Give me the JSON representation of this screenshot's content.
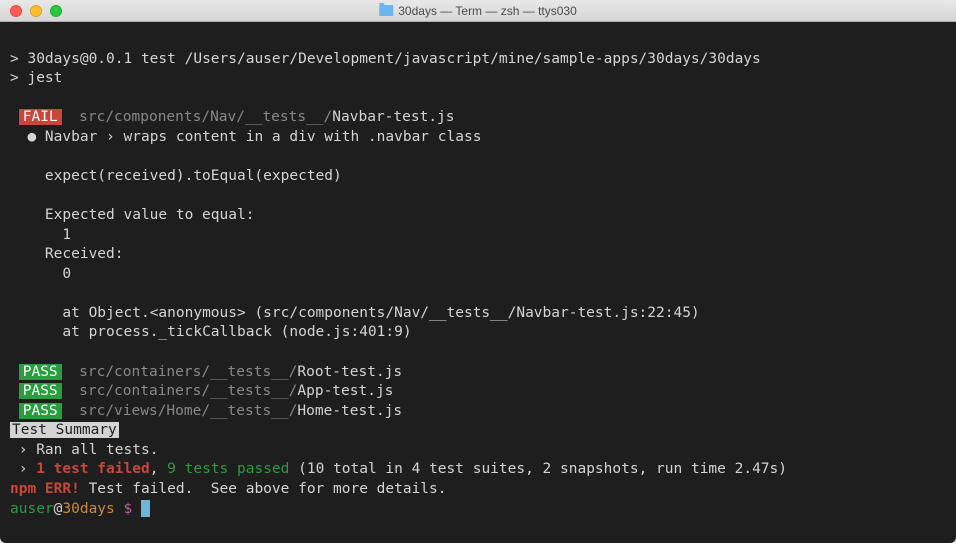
{
  "titlebar": {
    "title": "30days — Term — zsh — ttys030"
  },
  "cmd": {
    "line1_prefix": "> ",
    "line1": "30days@0.0.1 test /Users/auser/Development/javascript/mine/sample-apps/30days/30days",
    "line2_prefix": "> ",
    "line2": "jest"
  },
  "fail": {
    "badge": "FAIL",
    "path_dir": "src/components/Nav/__tests__/",
    "path_file": "Navbar-test.js",
    "bullet": "●",
    "desc": " Navbar › wraps content in a div with .navbar class",
    "expect_line": "expect(received).toEqual(expected)",
    "expected_label": "Expected value to equal:",
    "expected_val": "1",
    "received_label": "Received:",
    "received_val": "0",
    "stack1": "at Object.<anonymous> (src/components/Nav/__tests__/Navbar-test.js:22:45)",
    "stack2": "at process._tickCallback (node.js:401:9)"
  },
  "passes": [
    {
      "badge": "PASS",
      "dir": "src/containers/__tests__/",
      "file": "Root-test.js"
    },
    {
      "badge": "PASS",
      "dir": "src/containers/__tests__/",
      "file": "App-test.js"
    },
    {
      "badge": "PASS",
      "dir": "src/views/Home/__tests__/",
      "file": "Home-test.js"
    }
  ],
  "summary": {
    "heading": "Test Summary",
    "ran_prefix": " › ",
    "ran": "Ran all tests.",
    "result_prefix": " › ",
    "result_fail": "1 test failed",
    "result_sep": ", ",
    "result_pass": "9 tests passed",
    "result_rest": " (10 total in 4 test suites, 2 snapshots, run time 2.47s)"
  },
  "npm": {
    "err_label": "npm ERR!",
    "err_text": " Test failed.  See above for more details."
  },
  "prompt": {
    "user": "auser",
    "at": "@",
    "host": "30days",
    "dollar": " $ "
  }
}
